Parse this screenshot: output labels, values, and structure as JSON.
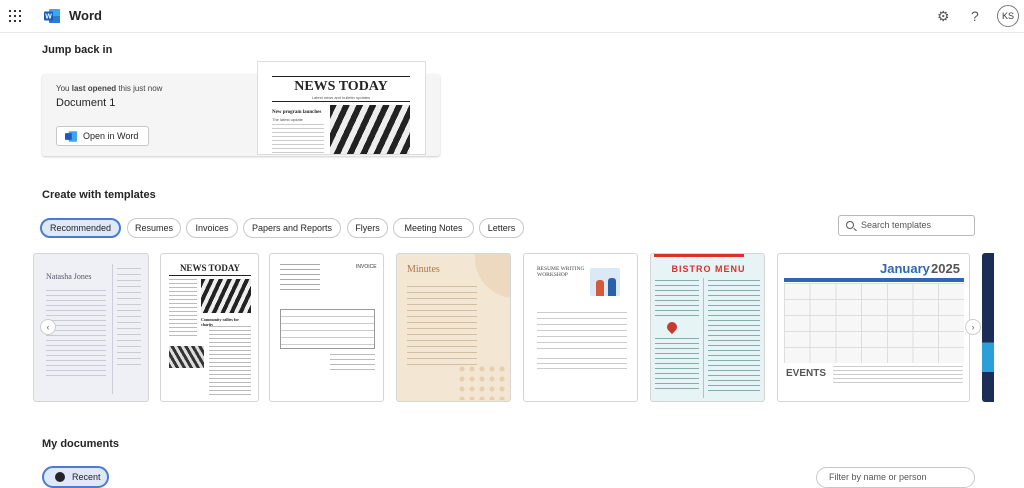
{
  "header": {
    "app_name": "Word",
    "help_glyph": "?",
    "settings_glyph": "⚙",
    "avatar_initials": "KS",
    "icons": [
      "app-launcher-icon",
      "word-logo-icon",
      "gear-icon",
      "help-icon"
    ]
  },
  "jump_back": {
    "heading": "Jump back in",
    "last_opened_prefix": "You ",
    "last_opened_bold": "last opened",
    "last_opened_suffix": " this just now",
    "doc_name": "Document 1",
    "open_button": "Open in Word",
    "thumb": {
      "masthead": "NEWS TODAY",
      "tagline": "Latest news and bulletin updates",
      "headline": "New program launches",
      "sub": "The latest update"
    }
  },
  "templates": {
    "heading": "Create with templates",
    "filters": [
      "Recommended",
      "Resumes",
      "Invoices",
      "Papers and Reports",
      "Flyers",
      "Meeting Notes",
      "Letters"
    ],
    "selected_filter": "Recommended",
    "search_placeholder": "Search templates",
    "cards": {
      "resume": {
        "name": "Natasha Jones"
      },
      "news": {
        "masthead": "NEWS TODAY",
        "headline": "Community rallies for charity"
      },
      "invoice": {
        "title": "INVOICE"
      },
      "minutes": {
        "title": "Minutes"
      },
      "workshop": {
        "title": "RESUME WRITING WORKSHOP"
      },
      "bistro": {
        "title": "BISTRO MENU"
      },
      "calendar": {
        "month": "January",
        "year": "2025",
        "events": "EVENTS"
      }
    }
  },
  "my_documents": {
    "heading": "My documents",
    "recent_tab": "Recent",
    "filter_placeholder": "Filter by name or person"
  },
  "colors": {
    "accent": "#4a7bd0",
    "word_blue": "#185abd",
    "bistro_red": "#d9302c",
    "calendar_blue": "#2e66b3"
  }
}
